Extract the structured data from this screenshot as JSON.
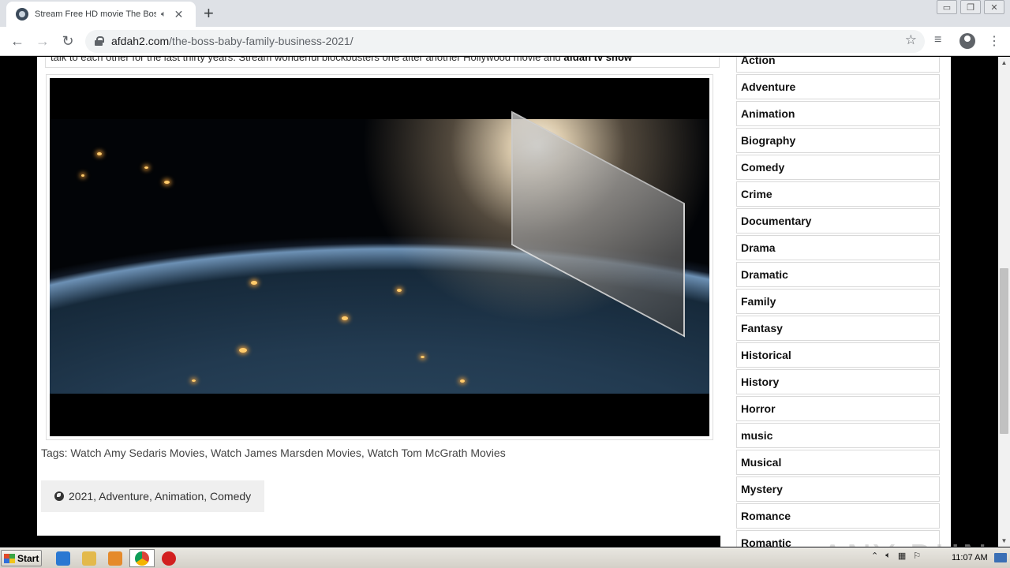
{
  "browser": {
    "tab_title": "Stream Free HD movie The Boss Baby",
    "audio_icon": "speaker-icon",
    "close_glyph": "✕",
    "newtab_glyph": "+",
    "url_domain": "afdah2.com",
    "url_path": "/the-boss-baby-family-business-2021/",
    "back_glyph": "←",
    "forward_glyph": "→",
    "reload_glyph": "↻",
    "star_glyph": "☆",
    "media_glyph": "≡",
    "menu_glyph": "⋮",
    "win_min": "▭",
    "win_max": "❐",
    "win_close": "✕"
  },
  "page": {
    "intro_text": "talk to each other for the last thirty years. Stream wonderful blockbusters one after another Hollywood movie and ",
    "intro_bold": "afdah tv show",
    "tags": "Tags: Watch Amy Sedaris Movies, Watch James Marsden Movies, Watch Tom McGrath Movies",
    "categories": "2021, Adventure, Animation, Comedy"
  },
  "genres": [
    "Action",
    "Adventure",
    "Animation",
    "Biography",
    "Comedy",
    "Crime",
    "Documentary",
    "Drama",
    "Dramatic",
    "Family",
    "Fantasy",
    "Historical",
    "History",
    "Horror",
    "music",
    "Musical",
    "Mystery",
    "Romance",
    "Romantic"
  ],
  "watermark": "ANY RUN",
  "taskbar": {
    "start_label": "Start",
    "clock": "11:07 AM"
  },
  "colors": {
    "tab_strip": "#dee1e6",
    "page_bg": "#000000",
    "content_bg": "#ffffff"
  }
}
